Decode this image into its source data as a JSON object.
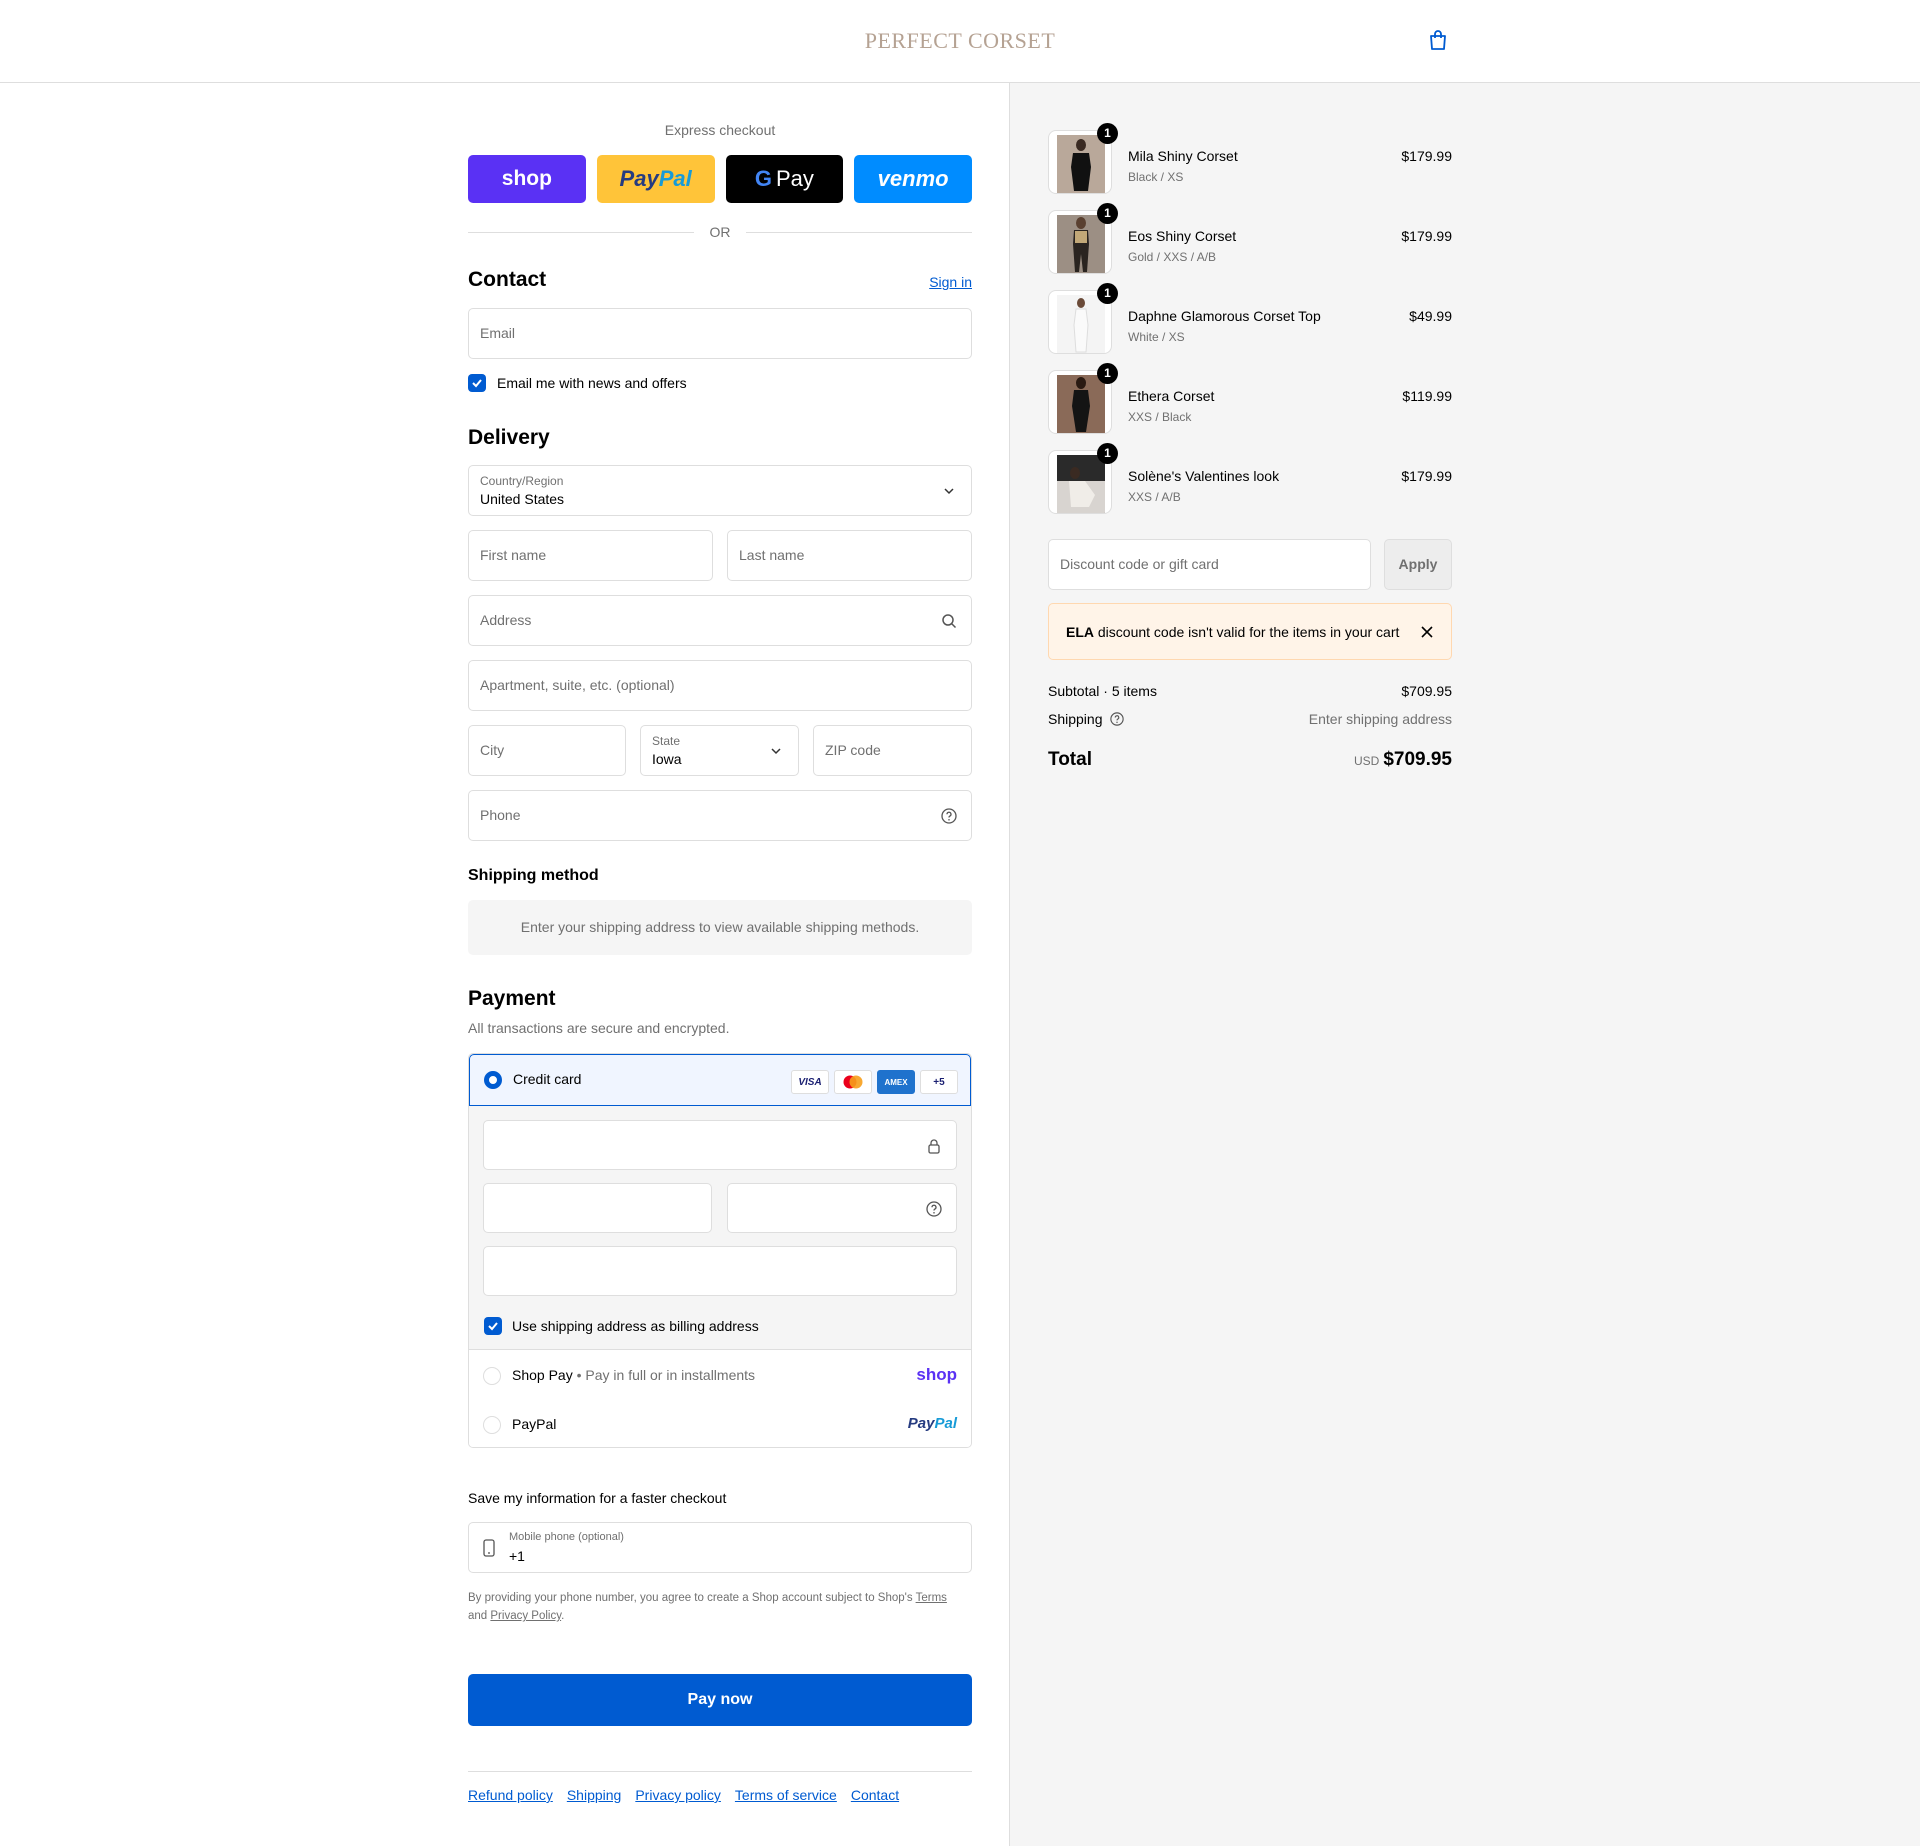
{
  "header": {
    "brand": "PERFECT CORSET",
    "bag_icon": "shopping-bag-icon"
  },
  "express": {
    "title": "Express checkout",
    "shop_label": "shop",
    "paypal_label_a": "Pay",
    "paypal_label_b": "Pal",
    "gpay_g": "G",
    "gpay_label": "Pay",
    "venmo_label": "venmo",
    "or_label": "OR"
  },
  "contact": {
    "heading": "Contact",
    "sign_in": "Sign in",
    "email_placeholder": "Email",
    "newsletter_label": "Email me with news and offers",
    "newsletter_checked": true
  },
  "delivery": {
    "heading": "Delivery",
    "country_label": "Country/Region",
    "country_value": "United States",
    "first_name": "First name",
    "last_name": "Last name",
    "address": "Address",
    "apartment": "Apartment, suite, etc. (optional)",
    "city": "City",
    "state_label": "State",
    "state_value": "Iowa",
    "zip": "ZIP code",
    "phone": "Phone"
  },
  "shipping_method": {
    "heading": "Shipping method",
    "notice": "Enter your shipping address to view available shipping methods."
  },
  "payment": {
    "heading": "Payment",
    "subtitle": "All transactions are secure and encrypted.",
    "credit_card_label": "Credit card",
    "card_logos": [
      "VISA",
      "AMEX",
      "+5"
    ],
    "billing_same_label": "Use shipping address as billing address",
    "shop_pay_label": "Shop Pay",
    "shop_pay_desc": "Pay in full or in installments",
    "shop_pay_logo": "shop",
    "paypal_label": "PayPal",
    "paypal_logo_a": "Pay",
    "paypal_logo_b": "Pal"
  },
  "save_info": {
    "heading": "Save my information for a faster checkout",
    "mobile_label": "Mobile phone (optional)",
    "mobile_value": "+1",
    "legal_prefix": "By providing your phone number, you agree to create a Shop account subject to Shop's ",
    "terms_link": "Terms",
    "legal_mid": "and ",
    "privacy_link": "Privacy Policy",
    "legal_end": "."
  },
  "pay_now": "Pay now",
  "footer_links": [
    "Refund policy",
    "Shipping",
    "Privacy policy",
    "Terms of service",
    "Contact"
  ],
  "cart": {
    "items": [
      {
        "name": "Mila Shiny Corset",
        "variant": "Black / XS",
        "price": "$179.99",
        "qty": "1"
      },
      {
        "name": "Eos Shiny Corset",
        "variant": "Gold / XXS / A/B",
        "price": "$179.99",
        "qty": "1"
      },
      {
        "name": "Daphne Glamorous Corset Top",
        "variant": "White / XS",
        "price": "$49.99",
        "qty": "1"
      },
      {
        "name": "Ethera Corset",
        "variant": "XXS / Black",
        "price": "$119.99",
        "qty": "1"
      },
      {
        "name": "Solène's Valentines look",
        "variant": "XXS / A/B",
        "price": "$179.99",
        "qty": "1"
      }
    ],
    "discount_placeholder": "Discount code or gift card",
    "apply_label": "Apply",
    "alert_code": "ELA",
    "alert_text": " discount code isn't valid for the items in your cart",
    "subtotal_label": "Subtotal · 5 items",
    "subtotal_value": "$709.95",
    "shipping_label": "Shipping",
    "shipping_value": "Enter shipping address",
    "total_label": "Total",
    "total_currency": "USD",
    "total_value": "$709.95"
  },
  "colors": {
    "accent": "#005bd1",
    "shop": "#5a31f4",
    "paypal": "#ffc439",
    "venmo": "#008cff",
    "brand": "#b5a293"
  }
}
